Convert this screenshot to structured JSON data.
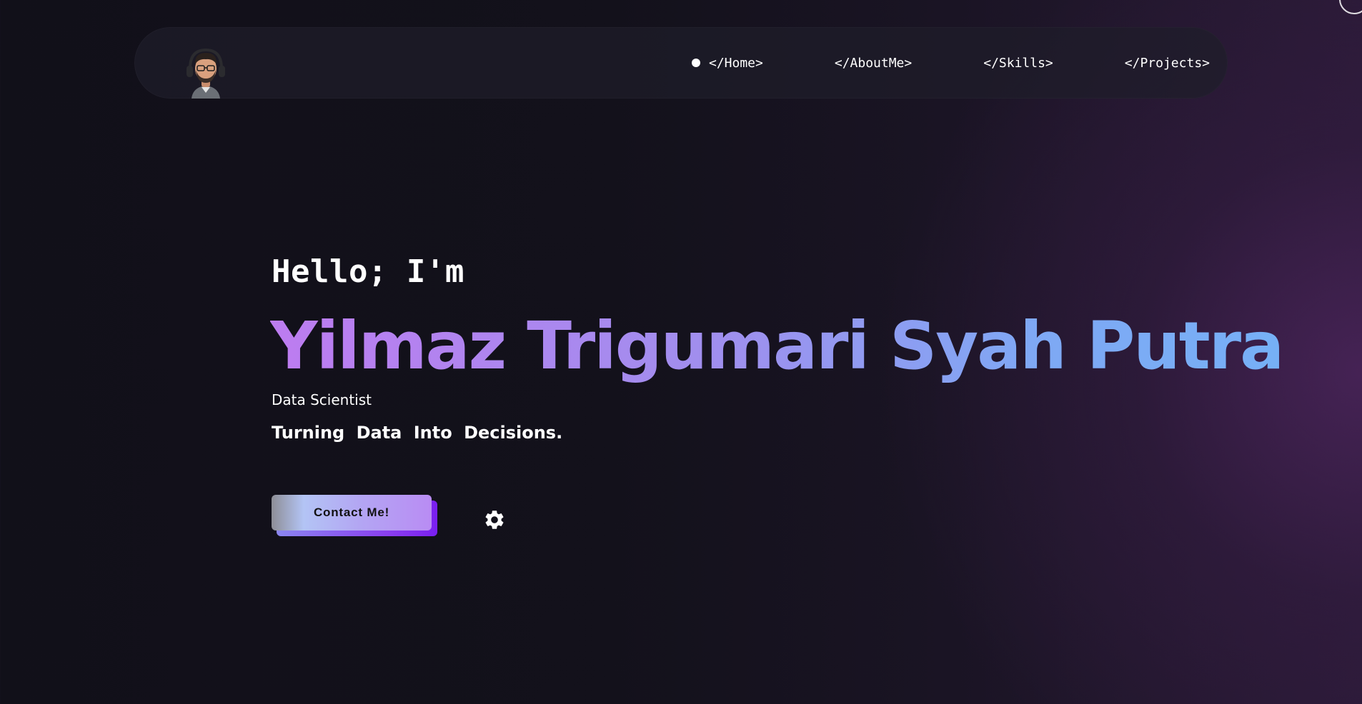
{
  "nav": {
    "items": [
      {
        "label": "</Home>",
        "active": true
      },
      {
        "label": "</AboutMe>",
        "active": false
      },
      {
        "label": "</Skills>",
        "active": false
      },
      {
        "label": "</Projects>",
        "active": false
      }
    ]
  },
  "hero": {
    "greeting": "Hello; I'm",
    "name": "Yilmaz Trigumari Syah Putra",
    "role": "Data Scientist",
    "tagline": "Turning Data Into Decisions.",
    "cta_label": "Contact Me!"
  },
  "colors": {
    "background": "#13111b",
    "name_gradient_start": "#bd7cf0",
    "name_gradient_end": "#76b0f6",
    "button_accent": "#8a3ef0"
  },
  "icons": {
    "avatar": "memoji-avatar",
    "settings": "gear-icon",
    "active_nav": "dot-indicator"
  }
}
